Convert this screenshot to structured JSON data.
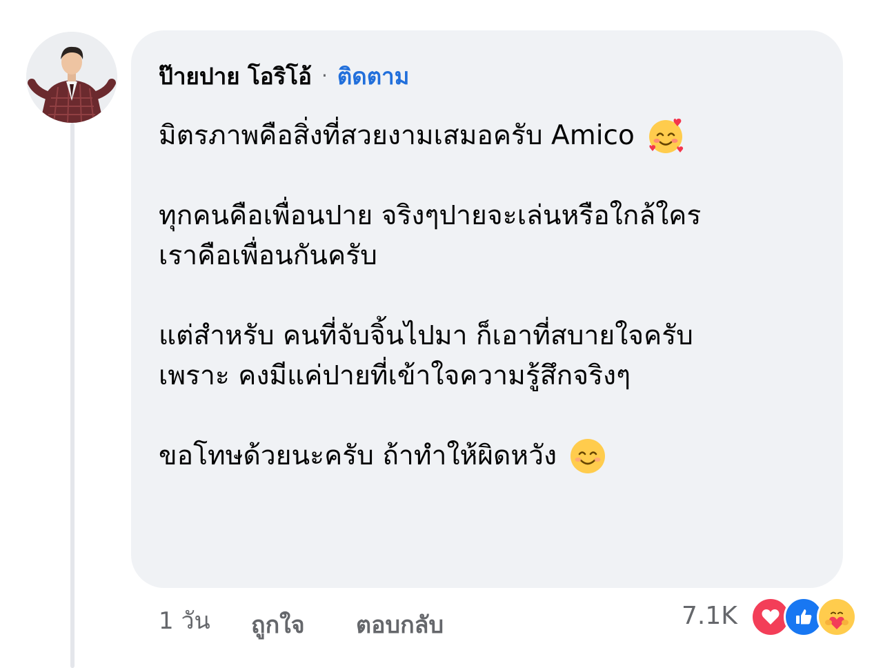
{
  "comment": {
    "author": "ป๊ายปาย โอริโอ้",
    "separator": "·",
    "follow_label": "ติดตาม",
    "paragraphs": [
      [
        "มิตรภาพคือสิ่งที่สวยงามเสมอครับ Amico"
      ],
      [
        "ทุกคนคือเพื่อนปาย จริงๆปายจะเล่นหรือใกล้ใคร",
        "เราคือเพื่อนกันครับ"
      ],
      [
        "แต่สำหรับ คนที่จับจิ้นไปมา ก็เอาที่สบายใจครับ",
        "เพราะ คงมีแค่ปายที่เข้าใจความรู้สึกจริงๆ"
      ],
      [
        "ขอโทษด้วยนะครับ ถ้าทำให้ผิดหวัง"
      ]
    ],
    "emojis": {
      "line_1": "smiling-face-with-hearts-emoji",
      "line_last": "smiling-face-emoji"
    }
  },
  "footer": {
    "time": "1 วัน",
    "like_label": "ถูกใจ",
    "reply_label": "ตอบกลับ",
    "reaction_count": "7.1K",
    "reactions": [
      "love-reaction-icon",
      "like-reaction-icon",
      "care-reaction-icon"
    ]
  },
  "colors": {
    "bubble_bg": "#f0f2f5",
    "link_blue": "#216fdb",
    "meta_gray": "#65676b",
    "love_red": "#f33e58",
    "like_blue": "#1877f2"
  }
}
